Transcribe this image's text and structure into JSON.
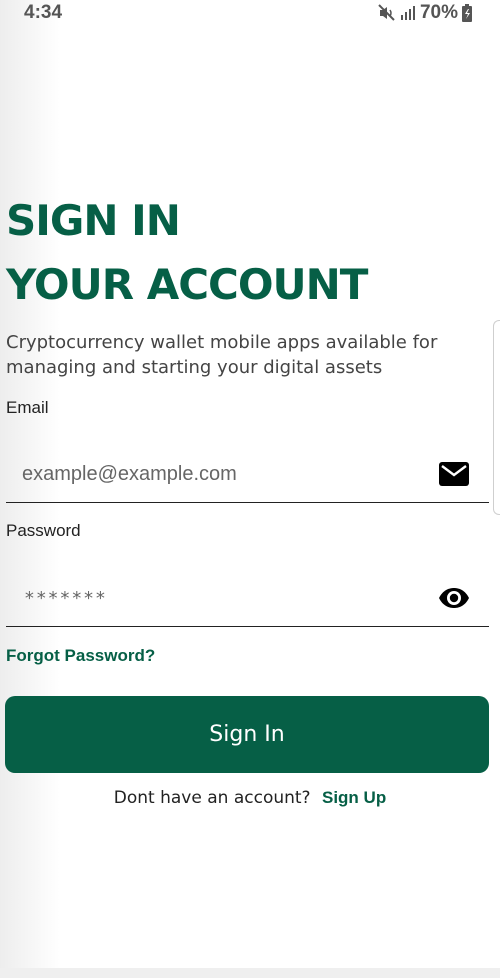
{
  "status_bar": {
    "time": "4:34",
    "battery": "70%"
  },
  "heading": {
    "line1": "SIGN IN",
    "line2": "YOUR ACCOUNT"
  },
  "subtitle": "Cryptocurrency wallet mobile apps available for managing and starting your digital assets",
  "email": {
    "label": "Email",
    "placeholder": "example@example.com",
    "icon": "mail-icon"
  },
  "password": {
    "label": "Password",
    "value": "*******",
    "icon": "eye-icon"
  },
  "forgot_password": "Forgot Password?",
  "sign_in_button": "Sign In",
  "signup": {
    "prompt": "Dont have an account?",
    "link": "Sign Up"
  },
  "colors": {
    "brand_green": "#065f46"
  }
}
